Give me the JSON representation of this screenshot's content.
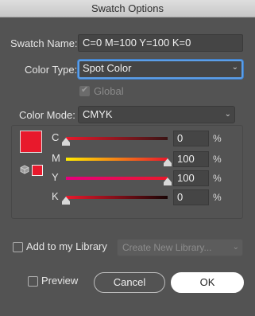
{
  "window": {
    "title": "Swatch Options"
  },
  "swatch_name": {
    "label": "Swatch Name:",
    "value": "C=0 M=100 Y=100 K=0"
  },
  "color_type": {
    "label": "Color Type:",
    "selected": "Spot Color",
    "focused": true
  },
  "global": {
    "label": "Global",
    "checked": true,
    "disabled": true
  },
  "color_mode": {
    "label": "Color Mode:",
    "selected": "CMYK"
  },
  "swatch_color": "#e8192c",
  "channels": [
    {
      "label": "C",
      "value": "0",
      "unit": "%",
      "percent": 0,
      "gradient": [
        "#e8192c",
        "#3a1414"
      ]
    },
    {
      "label": "M",
      "value": "100",
      "unit": "%",
      "percent": 100,
      "gradient": [
        "#ffeb00",
        "#e8192c"
      ]
    },
    {
      "label": "Y",
      "value": "100",
      "unit": "%",
      "percent": 100,
      "gradient": [
        "#e5007d",
        "#e8192c"
      ]
    },
    {
      "label": "K",
      "value": "0",
      "unit": "%",
      "percent": 0,
      "gradient": [
        "#e8192c",
        "#1a0505"
      ]
    }
  ],
  "library": {
    "label": "Add to my Library",
    "checked": false,
    "dropdown": "Create New Library..."
  },
  "preview": {
    "label": "Preview",
    "checked": false
  },
  "buttons": {
    "cancel": "Cancel",
    "ok": "OK"
  }
}
